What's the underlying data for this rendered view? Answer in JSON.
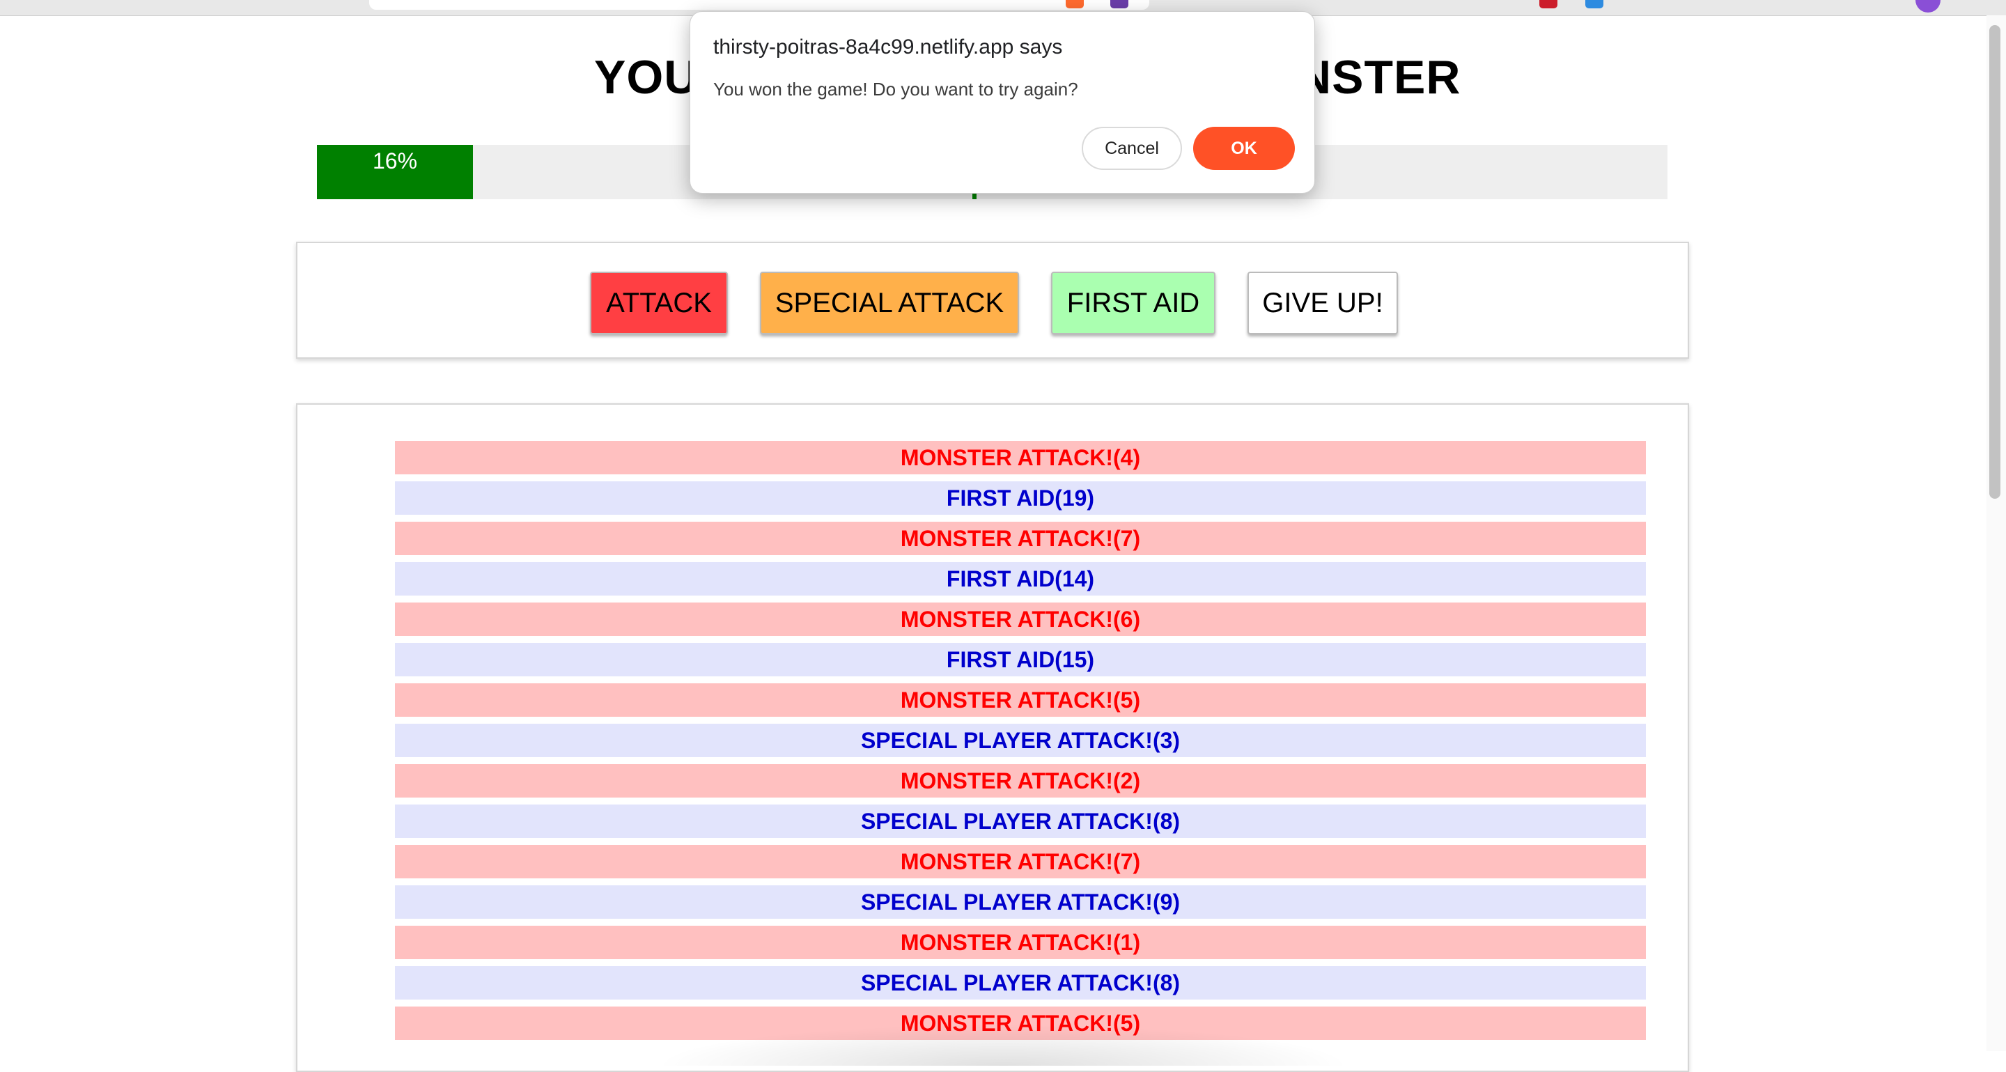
{
  "dialog": {
    "title": "thirsty-poitras-8a4c99.netlify.app says",
    "message": "You won the game! Do you want to try again?",
    "cancel_label": "Cancel",
    "ok_label": "OK"
  },
  "header": {
    "title_left_visible": "YOU",
    "title_right_visible": "NSTER"
  },
  "health": {
    "player_percent": 16,
    "player_label": "16%",
    "monster_percent": 0.6,
    "fill_color": "#008000"
  },
  "controls": {
    "attack_label": "ATTACK",
    "special_attack_label": "SPECIAL ATTACK",
    "first_aid_label": "FIRST AID",
    "give_up_label": "GIVE UP!"
  },
  "log": [
    {
      "type": "monster",
      "text": "MONSTER ATTACK!(4)"
    },
    {
      "type": "player",
      "text": "FIRST AID(19)"
    },
    {
      "type": "monster",
      "text": "MONSTER ATTACK!(7)"
    },
    {
      "type": "player",
      "text": "FIRST AID(14)"
    },
    {
      "type": "monster",
      "text": "MONSTER ATTACK!(6)"
    },
    {
      "type": "player",
      "text": "FIRST AID(15)"
    },
    {
      "type": "monster",
      "text": "MONSTER ATTACK!(5)"
    },
    {
      "type": "player",
      "text": "SPECIAL PLAYER ATTACK!(3)"
    },
    {
      "type": "monster",
      "text": "MONSTER ATTACK!(2)"
    },
    {
      "type": "player",
      "text": "SPECIAL PLAYER ATTACK!(8)"
    },
    {
      "type": "monster",
      "text": "MONSTER ATTACK!(7)"
    },
    {
      "type": "player",
      "text": "SPECIAL PLAYER ATTACK!(9)"
    },
    {
      "type": "monster",
      "text": "MONSTER ATTACK!(1)"
    },
    {
      "type": "player",
      "text": "SPECIAL PLAYER ATTACK!(8)"
    },
    {
      "type": "monster",
      "text": "MONSTER ATTACK!(5)"
    }
  ],
  "colors": {
    "monster_log_bg": "#ffc0c0",
    "monster_log_text": "#ff0000",
    "player_log_bg": "#e2e4fc",
    "player_log_text": "#0000cc",
    "attack_button": "#ff3f43",
    "special_button": "#ffb04a",
    "heal_button": "#aaffb0",
    "dialog_ok": "#ff5126"
  }
}
